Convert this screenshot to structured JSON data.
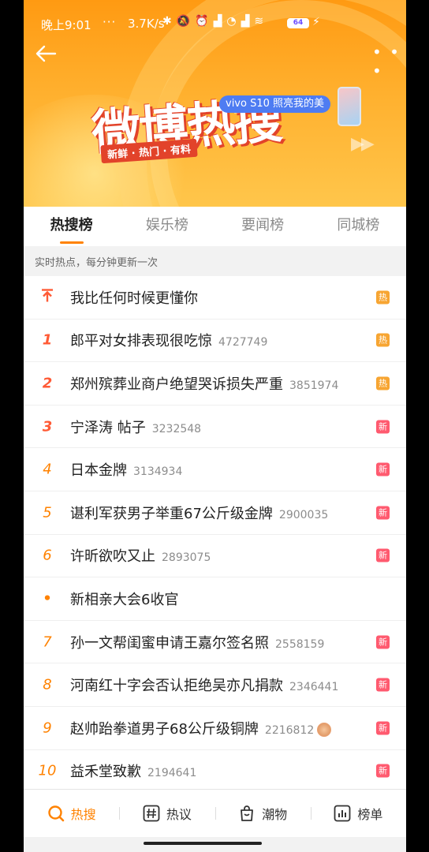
{
  "status_bar": {
    "time": "晚上9:01",
    "dots": "···",
    "speed": "3.7K/s",
    "battery": "64"
  },
  "header": {
    "logo_title": "微博热搜",
    "logo_slogan": "新鲜 · 热门 · 有料",
    "ad_text": "vivo S10 照亮我的美"
  },
  "tabs": [
    {
      "label": "热搜榜",
      "active": true
    },
    {
      "label": "娱乐榜",
      "active": false
    },
    {
      "label": "要闻榜",
      "active": false
    },
    {
      "label": "同城榜",
      "active": false
    }
  ],
  "hint": "实时热点，每分钟更新一次",
  "list": [
    {
      "rank": "",
      "rank_icon": "pin-top-icon",
      "title": "我比任何时候更懂你",
      "count": "",
      "badge": "热"
    },
    {
      "rank": "1",
      "title": "郎平对女排表现很吃惊",
      "count": "4727749",
      "badge": "热"
    },
    {
      "rank": "2",
      "title": "郑州殡葬业商户绝望哭诉损失严重",
      "count": "3851974",
      "badge": "热"
    },
    {
      "rank": "3",
      "title": "宁泽涛 帖子",
      "count": "3232548",
      "badge": "新"
    },
    {
      "rank": "4",
      "title": "日本金牌",
      "count": "3134934",
      "badge": "新"
    },
    {
      "rank": "5",
      "title": "谌利军获男子举重67公斤级金牌",
      "count": "2900035",
      "badge": "新"
    },
    {
      "rank": "6",
      "title": "许昕欲吹又止",
      "count": "2893075",
      "badge": "新"
    },
    {
      "rank": "•",
      "title": "新相亲大会6收官",
      "count": "",
      "badge": ""
    },
    {
      "rank": "7",
      "title": "孙一文帮闺蜜申请王嘉尔签名照",
      "count": "2558159",
      "badge": "新"
    },
    {
      "rank": "8",
      "title": "河南红十字会否认拒绝吴亦凡捐款",
      "count": "2346441",
      "badge": "新"
    },
    {
      "rank": "9",
      "title": "赵帅跆拳道男子68公斤级铜牌",
      "count": "2216812",
      "badge": "新",
      "medal": true
    },
    {
      "rank": "10",
      "title": "益禾堂致歉",
      "count": "2194641",
      "badge": "新"
    }
  ],
  "bottom_nav": [
    {
      "label": "热搜",
      "icon": "search-icon",
      "active": true
    },
    {
      "label": "热议",
      "icon": "hashtag-icon",
      "active": false
    },
    {
      "label": "潮物",
      "icon": "shopping-bag-icon",
      "active": false
    },
    {
      "label": "榜单",
      "icon": "chart-icon",
      "active": false
    }
  ]
}
